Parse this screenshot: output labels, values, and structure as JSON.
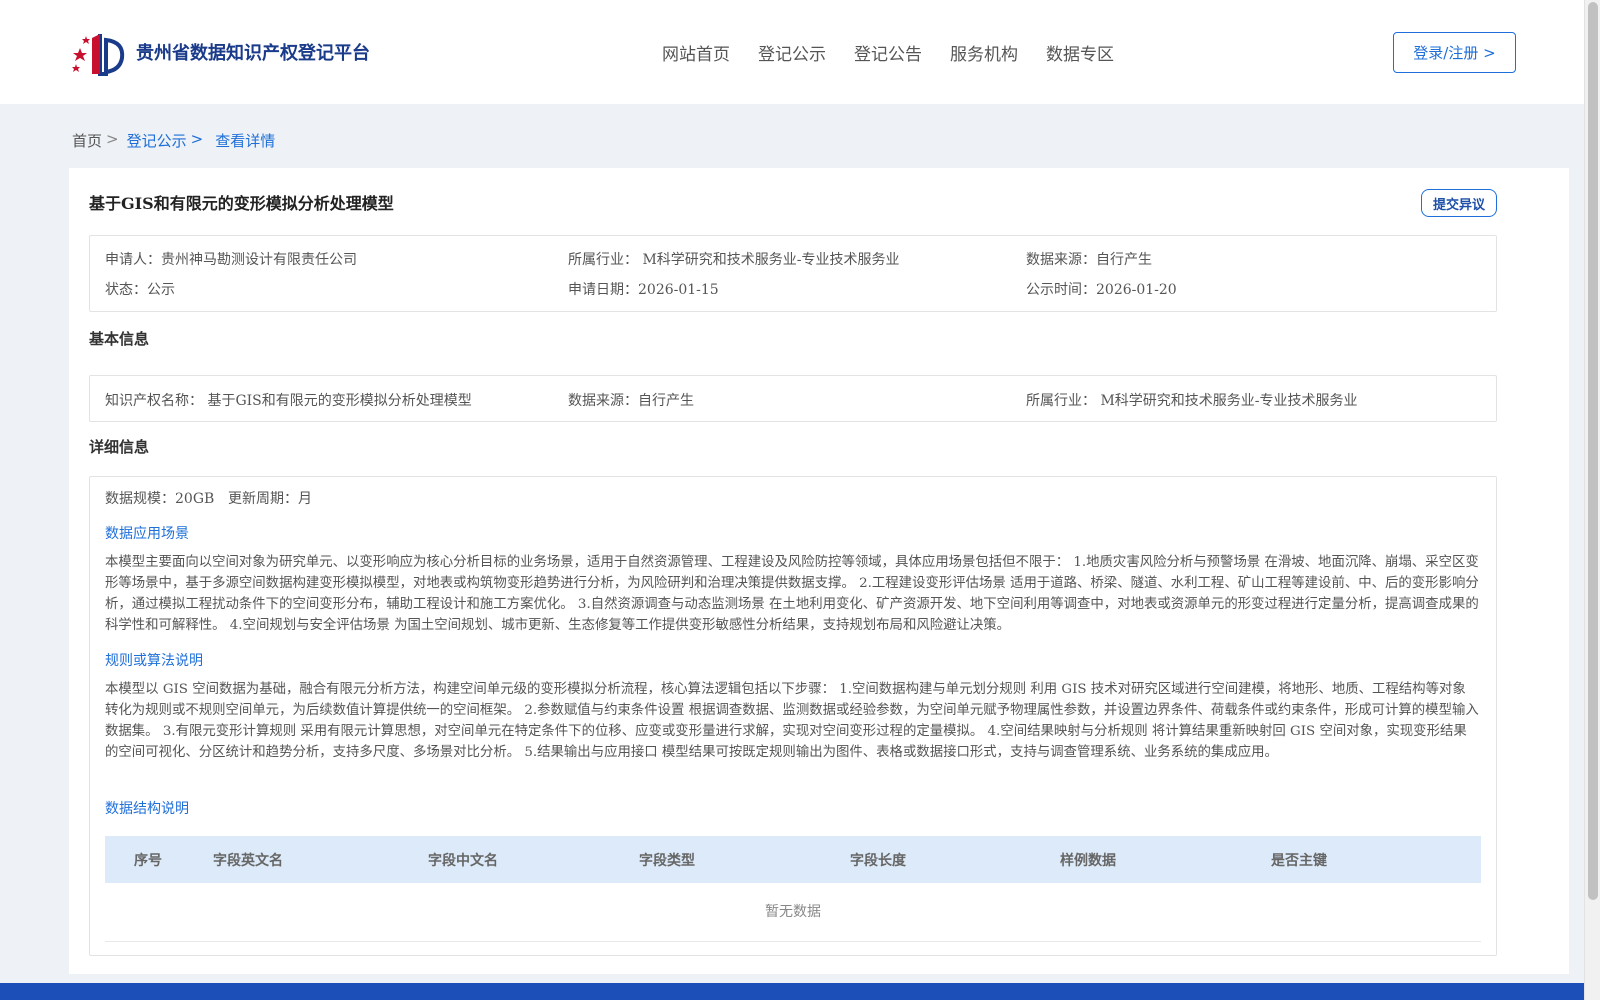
{
  "header": {
    "site_title": "贵州省数据知识产权登记平台",
    "nav": [
      "网站首页",
      "登记公示",
      "登记公告",
      "服务机构",
      "数据专区"
    ],
    "login_label": "登录/注册 >"
  },
  "breadcrumb": {
    "home": "首页",
    "sep": ">",
    "level1": "登记公示",
    "current": "查看详情"
  },
  "record": {
    "title": "基于GIS和有限元的变形模拟分析处理模型",
    "objection_label": "提交异议",
    "summary": {
      "applicant": "申请人：贵州神马勘测设计有限责任公司",
      "industry": "所属行业： M科学研究和技术服务业-专业技术服务业",
      "source": "数据来源：自行产生",
      "status": "状态：公示",
      "apply_date": "申请日期：2026-01-15",
      "publish_date": "公示时间：2026-01-20"
    }
  },
  "basic": {
    "label": "基本信息",
    "ip_name": "知识产权名称： 基于GIS和有限元的变形模拟分析处理模型",
    "source": "数据来源：自行产生",
    "industry": "所属行业： M科学研究和技术服务业-专业技术服务业"
  },
  "detail": {
    "label": "详细信息",
    "scale": "数据规模：20GB",
    "cycle": "更新周期：月",
    "scene_title": "数据应用场景",
    "scene_text": "本模型主要面向以空间对象为研究单元、以变形响应为核心分析目标的业务场景，适用于自然资源管理、工程建设及风险防控等领域，具体应用场景包括但不限于： 1.地质灾害风险分析与预警场景 在滑坡、地面沉降、崩塌、采空区变形等场景中，基于多源空间数据构建变形模拟模型，对地表或构筑物变形趋势进行分析，为风险研判和治理决策提供数据支撑。 2.工程建设变形评估场景 适用于道路、桥梁、隧道、水利工程、矿山工程等建设前、中、后的变形影响分析，通过模拟工程扰动条件下的空间变形分布，辅助工程设计和施工方案优化。 3.自然资源调查与动态监测场景 在土地利用变化、矿产资源开发、地下空间利用等调查中，对地表或资源单元的形变过程进行定量分析，提高调查成果的科学性和可解释性。 4.空间规划与安全评估场景 为国土空间规划、城市更新、生态修复等工作提供变形敏感性分析结果，支持规划布局和风险避让决策。",
    "rule_title": "规则或算法说明",
    "rule_text": "本模型以 GIS 空间数据为基础，融合有限元分析方法，构建空间单元级的变形模拟分析流程，核心算法逻辑包括以下步骤： 1.空间数据构建与单元划分规则 利用 GIS 技术对研究区域进行空间建模，将地形、地质、工程结构等对象转化为规则或不规则空间单元，为后续数值计算提供统一的空间框架。 2.参数赋值与约束条件设置 根据调查数据、监测数据或经验参数，为空间单元赋予物理属性参数，并设置边界条件、荷载条件或约束条件，形成可计算的模型输入数据集。 3.有限元变形计算规则 采用有限元计算思想，对空间单元在特定条件下的位移、应变或变形量进行求解，实现对空间变形过程的定量模拟。 4.空间结果映射与分析规则 将计算结果重新映射回 GIS 空间对象，实现变形结果的空间可视化、分区统计和趋势分析，支持多尺度、多场景对比分析。 5.结果输出与应用接口 模型结果可按既定规则输出为图件、表格或数据接口形式，支持与调查管理系统、业务系统的集成应用。",
    "struct_title": "数据结构说明",
    "columns": [
      "序号",
      "字段英文名",
      "字段中文名",
      "字段类型",
      "字段长度",
      "样例数据",
      "是否主键"
    ],
    "empty_text": "暂无数据"
  }
}
